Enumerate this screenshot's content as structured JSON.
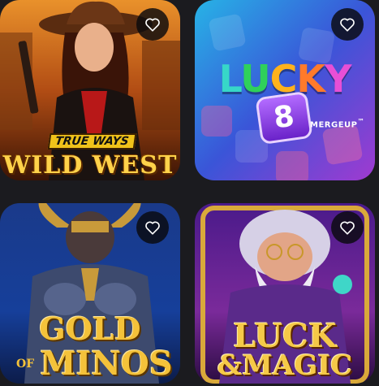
{
  "games": [
    {
      "id_label": "wild-west",
      "badge": "TRUE WAYS",
      "title": "WILD WEST",
      "favorite_icon": "heart-outline-icon"
    },
    {
      "id_label": "lucky-8",
      "title_letters": [
        "L",
        "U",
        "C",
        "K",
        "Y"
      ],
      "number": "8",
      "subtitle": "MERGEUP",
      "trademark": "™",
      "favorite_icon": "heart-outline-icon"
    },
    {
      "id_label": "gold-of-minos",
      "title_top": "GOLD",
      "title_of": "OF",
      "title_bottom": "MINOS",
      "favorite_icon": "heart-outline-icon"
    },
    {
      "id_label": "luck-and-magic",
      "title_top": "LUCK",
      "title_bottom": "&MAGIC",
      "favorite_icon": "heart-outline-icon"
    }
  ],
  "colors": {
    "background": "#1b1b1f",
    "favorite_button_bg": "#0a0a0e",
    "heart_stroke": "#ffffff"
  }
}
